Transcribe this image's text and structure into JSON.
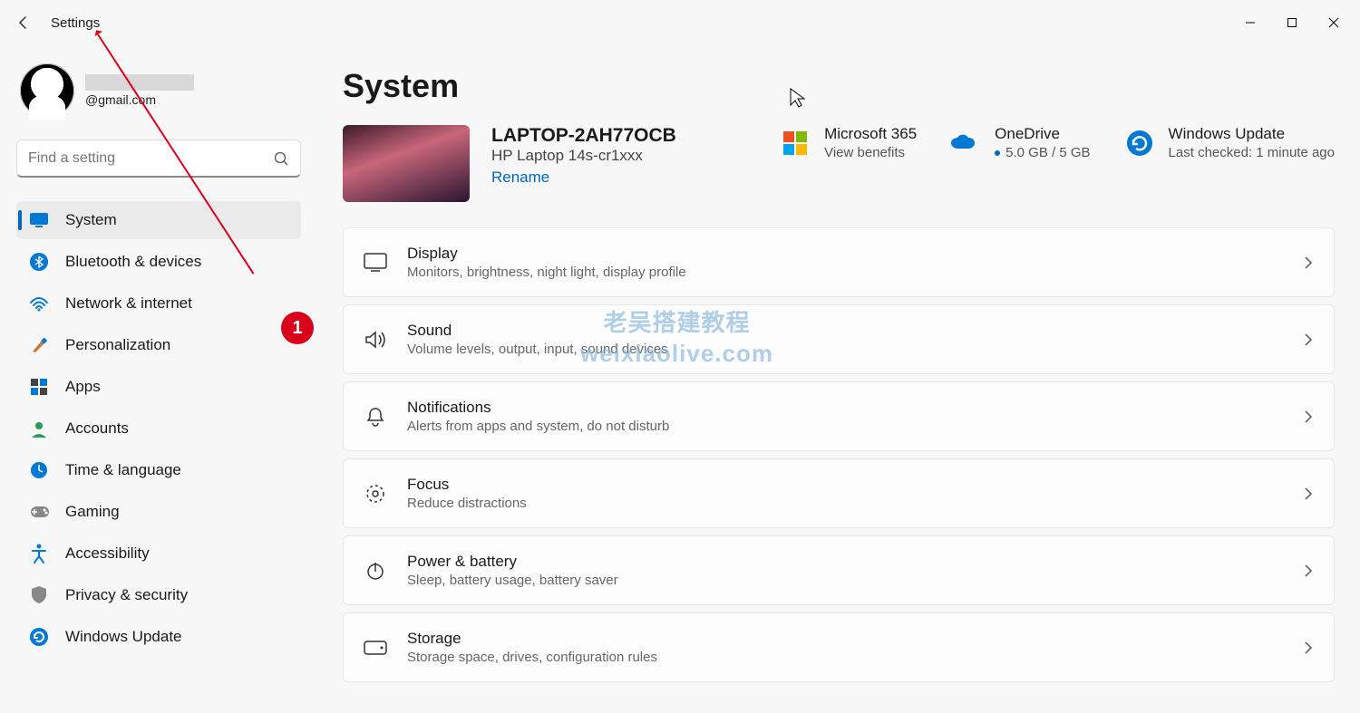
{
  "window": {
    "title": "Settings"
  },
  "user": {
    "email": "@gmail.com"
  },
  "search": {
    "placeholder": "Find a setting"
  },
  "nav": [
    {
      "label": "System"
    },
    {
      "label": "Bluetooth & devices"
    },
    {
      "label": "Network & internet"
    },
    {
      "label": "Personalization"
    },
    {
      "label": "Apps"
    },
    {
      "label": "Accounts"
    },
    {
      "label": "Time & language"
    },
    {
      "label": "Gaming"
    },
    {
      "label": "Accessibility"
    },
    {
      "label": "Privacy & security"
    },
    {
      "label": "Windows Update"
    }
  ],
  "page": {
    "title": "System"
  },
  "device": {
    "name": "LAPTOP-2AH77OCB",
    "model": "HP Laptop 14s-cr1xxx",
    "rename": "Rename"
  },
  "status": {
    "m365": {
      "title": "Microsoft 365",
      "sub": "View benefits"
    },
    "onedrive": {
      "title": "OneDrive",
      "sub": "5.0 GB / 5 GB"
    },
    "update": {
      "title": "Windows Update",
      "sub": "Last checked: 1 minute ago"
    }
  },
  "cards": [
    {
      "title": "Display",
      "sub": "Monitors, brightness, night light, display profile"
    },
    {
      "title": "Sound",
      "sub": "Volume levels, output, input, sound devices"
    },
    {
      "title": "Notifications",
      "sub": "Alerts from apps and system, do not disturb"
    },
    {
      "title": "Focus",
      "sub": "Reduce distractions"
    },
    {
      "title": "Power & battery",
      "sub": "Sleep, battery usage, battery saver"
    },
    {
      "title": "Storage",
      "sub": "Storage space, drives, configuration rules"
    }
  ],
  "annotations": {
    "badge": "1",
    "watermark_line1": "老吴搭建教程",
    "watermark_line2": "weixiaolive.com"
  }
}
